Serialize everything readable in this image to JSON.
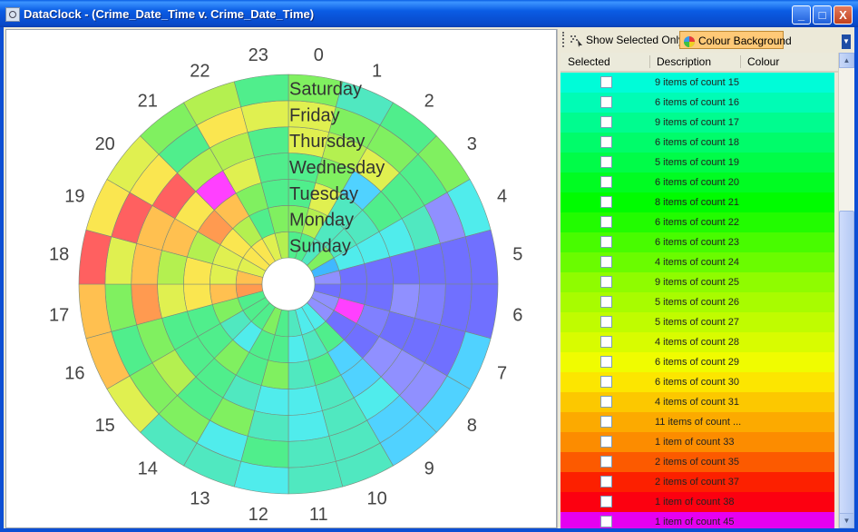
{
  "window": {
    "title": "DataClock - (Crime_Date_Time v. Crime_Date_Time)",
    "buttons": {
      "minimize": "_",
      "maximize": "□",
      "close": "X"
    }
  },
  "toolbar": {
    "show_selected_label": "Show Selected Only",
    "colour_background_label": "Colour Background",
    "colour_background_pressed": true
  },
  "grid": {
    "headers": {
      "selected": "Selected",
      "description": "Description",
      "colour": "Colour"
    },
    "rows": [
      {
        "description": "9 items of count 15",
        "color": "#00fcd8"
      },
      {
        "description": "6 items of count 16",
        "color": "#00fcb5"
      },
      {
        "description": "9 items of count 17",
        "color": "#00fc8f"
      },
      {
        "description": "6 items of count 18",
        "color": "#00fc6a"
      },
      {
        "description": "5 items of count 19",
        "color": "#00fc48"
      },
      {
        "description": "6 items of count 20",
        "color": "#00fc22"
      },
      {
        "description": "8 items of count 21",
        "color": "#00fc00"
      },
      {
        "description": "6 items of count 22",
        "color": "#22fc00"
      },
      {
        "description": "6 items of count 23",
        "color": "#48fc00"
      },
      {
        "description": "4 items of count 24",
        "color": "#6afc00"
      },
      {
        "description": "9 items of count 25",
        "color": "#8ffc00"
      },
      {
        "description": "5 items of count 26",
        "color": "#a8fc00"
      },
      {
        "description": "5 items of count 27",
        "color": "#c0fc00"
      },
      {
        "description": "4 items of count 28",
        "color": "#d8fc00"
      },
      {
        "description": "6 items of count 29",
        "color": "#f0fc00"
      },
      {
        "description": "6 items of count 30",
        "color": "#fce600"
      },
      {
        "description": "4 items of count 31",
        "color": "#fcc800"
      },
      {
        "description": "11 items of count ...",
        "color": "#fcaa00"
      },
      {
        "description": "1 item of count 33",
        "color": "#fc8c00"
      },
      {
        "description": "2 items of count 35",
        "color": "#fc5a00"
      },
      {
        "description": "2 items of count 37",
        "color": "#fc2000"
      },
      {
        "description": "1 item of count 38",
        "color": "#fc0010"
      },
      {
        "description": "1 item of count 45",
        "color": "#e600f0"
      }
    ]
  },
  "clock": {
    "hours": [
      "0",
      "1",
      "2",
      "3",
      "4",
      "5",
      "6",
      "7",
      "8",
      "9",
      "10",
      "11",
      "12",
      "13",
      "14",
      "15",
      "16",
      "17",
      "18",
      "19",
      "20",
      "21",
      "22",
      "23"
    ],
    "days": [
      "Sunday",
      "Monday",
      "Tuesday",
      "Wednesday",
      "Thursday",
      "Friday",
      "Saturday"
    ],
    "palette": {
      "A": "#40b8ff",
      "B": "#50d2ff",
      "C": "#50ecec",
      "D": "#50e8c0",
      "E": "#50ee8c",
      "F": "#80f060",
      "G": "#b4f050",
      "H": "#e0f050",
      "I": "#fae650",
      "J": "#ffc050",
      "K": "#ff9a50",
      "L": "#ff6060",
      "M": "#ff40ff",
      "N": "#7070ff",
      "O": "#9090ff",
      "P": "#8080ff",
      "Q": "#ffb040"
    },
    "cells": [
      "EEDFAONOOCCDEFEEEKJHIIHG",
      "FGDDCNNMNEDCEECDFJHHIGEF",
      "EHDDCNNPNBEDFEFEEIIGKJFE",
      "EFBECNONOBDCCDEEEHGJIMHE",
      "HGHEDNPNOCDCDFEGFKJJLGGE",
      "HFFEONNNOBDDECFFEFHLIEIH",
      "FDEFCNNBBBDDCDDHJJLIHFG"
    ]
  }
}
